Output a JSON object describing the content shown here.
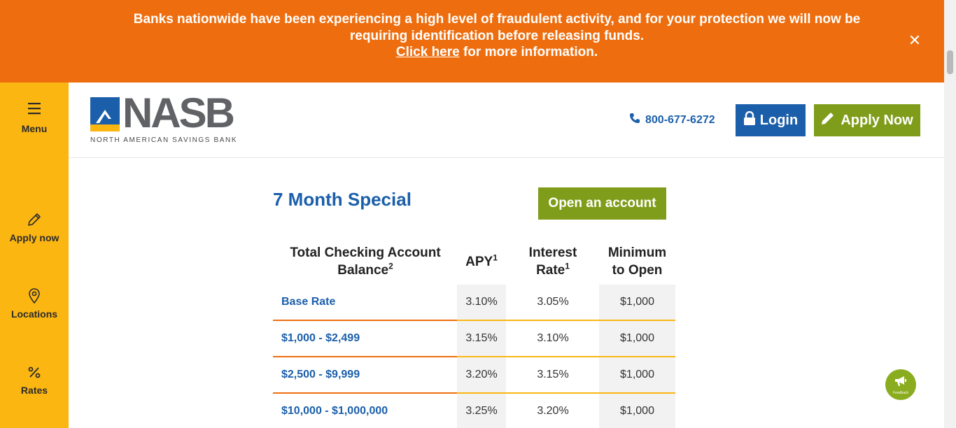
{
  "alert": {
    "line1": "Banks nationwide have been experiencing a high level of fraudulent activity, and for your protection we will now be requiring identification before releasing funds.",
    "link_text": "Click here",
    "link_suffix": " for more information.",
    "close_symbol": "✕"
  },
  "sidebar": {
    "items": [
      {
        "label": "Menu",
        "icon": "hamburger-icon"
      },
      {
        "label": "Apply now",
        "icon": "pencil-icon"
      },
      {
        "label": "Locations",
        "icon": "map-pin-icon"
      },
      {
        "label": "Rates",
        "icon": "percent-icon"
      }
    ]
  },
  "header": {
    "logo_word": "NASB",
    "logo_tagline": "NORTH AMERICAN SAVINGS BANK",
    "phone": "800-677-6272",
    "login_label": "Login",
    "apply_label": "Apply Now"
  },
  "main": {
    "title": "7 Month Special",
    "open_account_label": "Open an account",
    "table": {
      "headers": {
        "balance": "Total Checking Account Balance",
        "balance_sup": "2",
        "apy": "APY",
        "apy_sup": "1",
        "rate": "Interest Rate",
        "rate_sup": "1",
        "min": "Minimum to Open"
      },
      "rows": [
        {
          "label": "Base Rate",
          "apy": "3.10%",
          "rate": "3.05%",
          "min": "$1,000"
        },
        {
          "label": "$1,000 - $2,499",
          "apy": "3.15%",
          "rate": "3.10%",
          "min": "$1,000"
        },
        {
          "label": "$2,500 - $9,999",
          "apy": "3.20%",
          "rate": "3.15%",
          "min": "$1,000"
        },
        {
          "label": "$10,000 - $1,000,000",
          "apy": "3.25%",
          "rate": "3.20%",
          "min": "$1,000"
        }
      ]
    }
  },
  "feedback": {
    "label": "Feedback"
  },
  "colors": {
    "alert_orange": "#ee6e0f",
    "sidebar_yellow": "#fbb612",
    "brand_blue": "#1b5faa",
    "brand_green": "#7f9d1a"
  }
}
